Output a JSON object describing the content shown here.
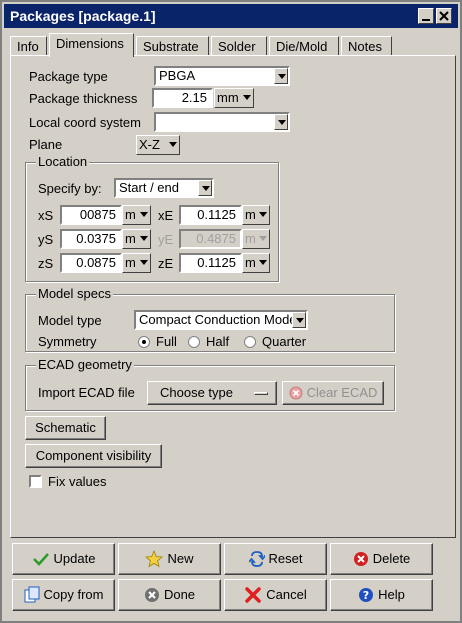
{
  "window": {
    "title": "Packages [package.1]"
  },
  "tabs": [
    "Info",
    "Dimensions",
    "Substrate",
    "Solder",
    "Die/Mold",
    "Notes"
  ],
  "active_tab": "Dimensions",
  "form": {
    "package_type": {
      "label": "Package type",
      "value": "PBGA"
    },
    "package_thickness": {
      "label": "Package thickness",
      "value": "2.15",
      "unit": "mm"
    },
    "local_coord": {
      "label": "Local coord system",
      "value": ""
    },
    "plane": {
      "label": "Plane",
      "value": "X-Z"
    }
  },
  "location": {
    "title": "Location",
    "specify_label": "Specify by:",
    "specify_value": "Start / end",
    "xS": {
      "label": "xS",
      "value": "00875",
      "unit": "m"
    },
    "yS": {
      "label": "yS",
      "value": "0.0375",
      "unit": "m"
    },
    "zS": {
      "label": "zS",
      "value": "0.0875",
      "unit": "m"
    },
    "xE": {
      "label": "xE",
      "value": "0.1125",
      "unit": "m"
    },
    "yE": {
      "label": "yE",
      "value": "0.4875",
      "unit": "m"
    },
    "zE": {
      "label": "zE",
      "value": "0.1125",
      "unit": "m"
    }
  },
  "model_specs": {
    "title": "Model specs",
    "model_type_label": "Model type",
    "model_type_value": "Compact Conduction Model",
    "symmetry_label": "Symmetry",
    "symmetry_options": [
      "Full",
      "Half",
      "Quarter"
    ],
    "symmetry_selected": "Full"
  },
  "ecad": {
    "title": "ECAD geometry",
    "import_label": "Import ECAD file",
    "choose_label": "Choose type",
    "clear_label": "Clear ECAD"
  },
  "buttons": {
    "schematic": "Schematic",
    "visibility": "Component visibility",
    "fix_values": "Fix values",
    "update": "Update",
    "new": "New",
    "reset": "Reset",
    "delete": "Delete",
    "copy_from": "Copy from",
    "done": "Done",
    "cancel": "Cancel",
    "help": "Help"
  },
  "colors": {
    "titlebar": "#0a246a",
    "face": "#d4d0c8"
  }
}
